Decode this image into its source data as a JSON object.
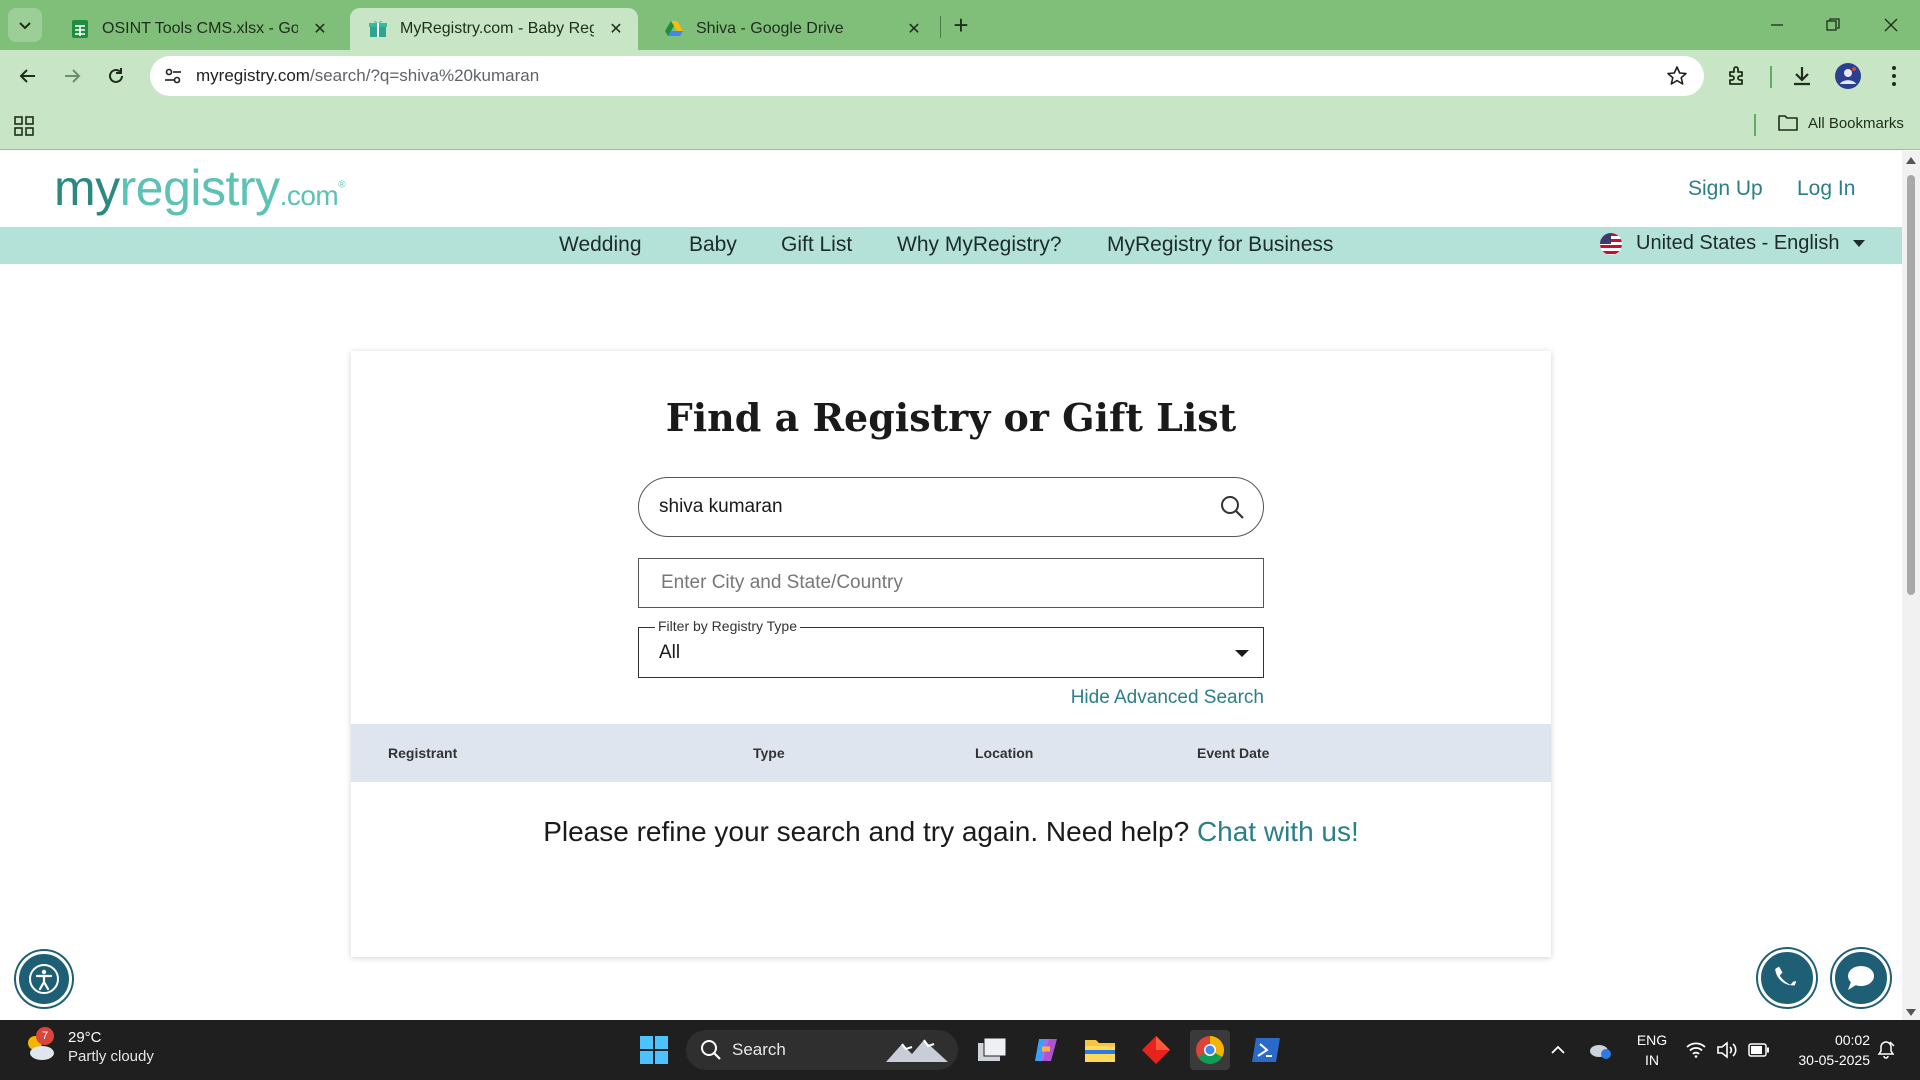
{
  "browser": {
    "tabs": [
      {
        "title": "OSINT Tools CMS.xlsx - Google",
        "icon": "google-sheets-icon",
        "active": false
      },
      {
        "title": "MyRegistry.com - Baby Registry",
        "icon": "myregistry-gift-icon",
        "active": true
      },
      {
        "title": "Shiva - Google Drive",
        "icon": "google-drive-icon",
        "active": false
      }
    ],
    "url_domain": "myregistry.com",
    "url_path": "/search/?q=shiva%20kumaran",
    "bookmarks_label": "All Bookmarks",
    "theme_color": "#7fbf7a"
  },
  "site": {
    "logo": {
      "my": "my",
      "registry": "registry",
      "dotcom": ".com"
    },
    "sign_up": "Sign Up",
    "log_in": "Log In",
    "nav": [
      "Wedding",
      "Baby",
      "Gift List",
      "Why MyRegistry?",
      "MyRegistry for Business"
    ],
    "locale": "United States - English",
    "accent_color": "#2a7f8a",
    "nav_bg_color": "#b4e2d9"
  },
  "search_card": {
    "title": "Find a Registry or Gift List",
    "query_value": "shiva kumaran",
    "city_placeholder": "Enter City and State/Country",
    "filter_label": "Filter by Registry Type",
    "filter_value": "All",
    "hide_advanced": "Hide Advanced Search",
    "columns": [
      "Registrant",
      "Type",
      "Location",
      "Event Date"
    ],
    "empty_message": "Please refine your search and try again. Need help?",
    "chat_link": "Chat with us!"
  },
  "taskbar": {
    "weather_badge": "7",
    "temperature": "29°C",
    "condition": "Partly cloudy",
    "search_label": "Search",
    "lang_line1": "ENG",
    "lang_line2": "IN",
    "time": "00:02",
    "date": "30-05-2025"
  }
}
